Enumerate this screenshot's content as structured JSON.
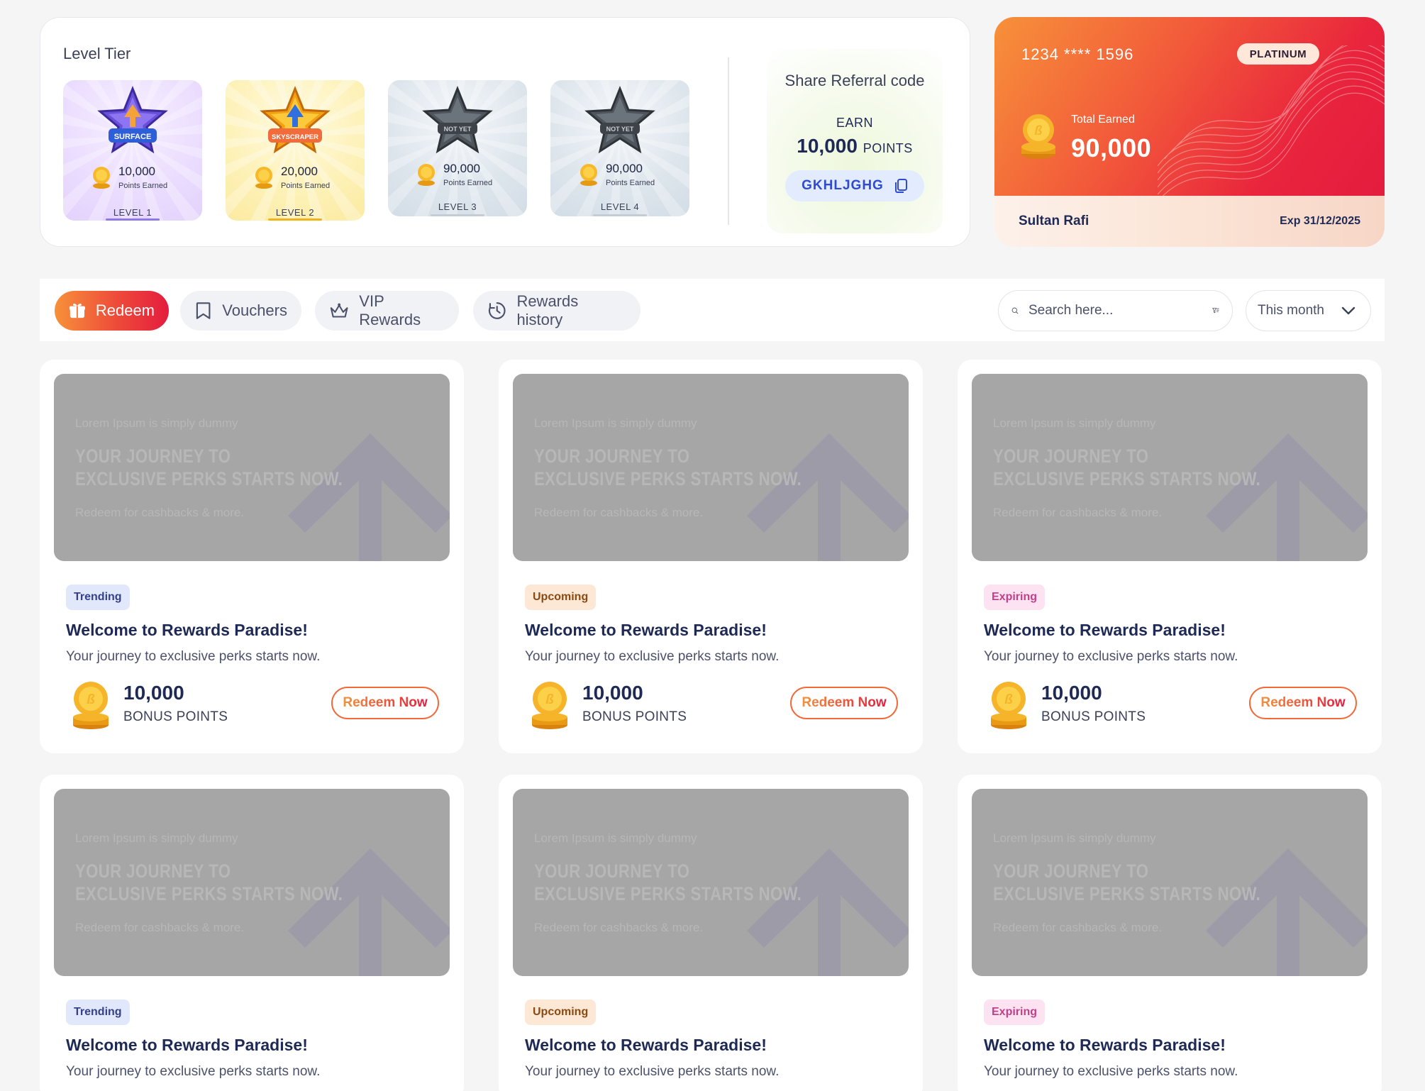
{
  "tiers": {
    "title": "Level Tier",
    "items": [
      {
        "badge": "SURFACE",
        "points": "10,000",
        "points_label": "Points Earned",
        "level": "LEVEL 1"
      },
      {
        "badge": "SKYSCRAPER",
        "points": "20,000",
        "points_label": "Points Earned",
        "level": "LEVEL 2"
      },
      {
        "badge": "NOT YET",
        "points": "90,000",
        "points_label": "Points Earned",
        "level": "LEVEL 3"
      },
      {
        "badge": "NOT YET",
        "points": "90,000",
        "points_label": "Points Earned",
        "level": "LEVEL 4"
      }
    ]
  },
  "referral": {
    "title": "Share Referral code",
    "earn_label": "EARN",
    "earn_value": "10,000",
    "earn_unit": "POINTS",
    "code": "GKHLJGHG",
    "copy_icon": "copy-icon"
  },
  "card": {
    "number": "1234 **** 1596",
    "tier": "PLATINUM",
    "earned_label": "Total Earned",
    "earned_value": "90,000",
    "holder": "Sultan Rafi",
    "expiry": "Exp 31/12/2025"
  },
  "tabs": [
    {
      "label": "Redeem",
      "icon": "gift-icon",
      "active": true
    },
    {
      "label": "Vouchers",
      "icon": "bookmark-icon",
      "active": false
    },
    {
      "label": "VIP Rewards",
      "icon": "crown-icon",
      "active": false
    },
    {
      "label": "Rewards history",
      "icon": "history-icon",
      "active": false
    }
  ],
  "search": {
    "placeholder": "Search here...",
    "icon": "search-icon",
    "filter_icon": "filter-icon"
  },
  "period": {
    "selected": "This month",
    "icon": "chevron-down-icon"
  },
  "banner": {
    "small": "Lorem Ipsum is simply dummy",
    "big_line1": "YOUR JOURNEY TO",
    "big_line2": "EXCLUSIVE PERKS STARTS NOW.",
    "sub": "Redeem for cashbacks & more."
  },
  "rewards": [
    {
      "tag": "Trending",
      "title": "Welcome to Rewards Paradise!",
      "desc": "Your journey to exclusive perks starts now.",
      "points": "10,000",
      "points_label": "BONUS POINTS",
      "button": "Redeem Now"
    },
    {
      "tag": "Upcoming",
      "title": "Welcome to Rewards Paradise!",
      "desc": "Your journey to exclusive perks starts now.",
      "points": "10,000",
      "points_label": "BONUS POINTS",
      "button": "Redeem Now"
    },
    {
      "tag": "Expiring",
      "title": "Welcome to Rewards Paradise!",
      "desc": "Your journey to exclusive perks starts now.",
      "points": "10,000",
      "points_label": "BONUS POINTS",
      "button": "Redeem Now"
    },
    {
      "tag": "Trending",
      "title": "Welcome to Rewards Paradise!",
      "desc": "Your journey to exclusive perks starts now."
    },
    {
      "tag": "Upcoming",
      "title": "Welcome to Rewards Paradise!",
      "desc": "Your journey to exclusive perks starts now."
    },
    {
      "tag": "Expiring",
      "title": "Welcome to Rewards Paradise!",
      "desc": "Your journey to exclusive perks starts now."
    }
  ],
  "colors": {
    "accent_start": "#f7913a",
    "accent_end": "#e41c3e",
    "navy": "#1e2a55",
    "tag_trending": "#e2e8fb",
    "tag_upcoming": "#fde8d6",
    "tag_expiring": "#fde3f1"
  }
}
